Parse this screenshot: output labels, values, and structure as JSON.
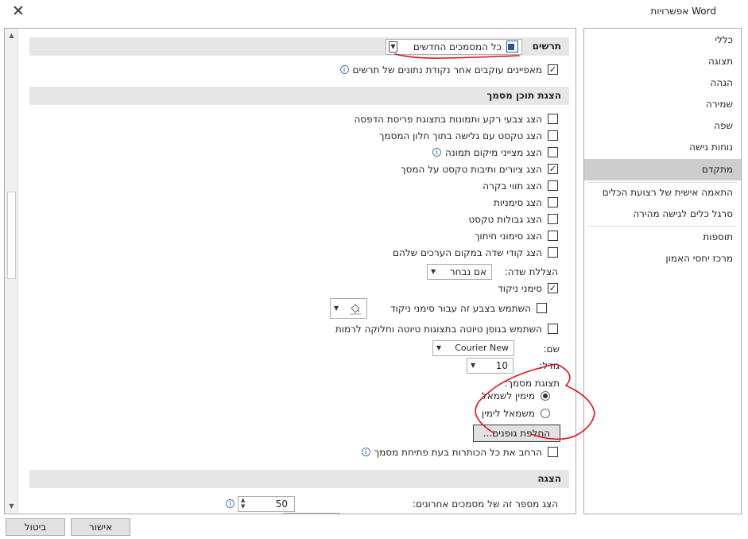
{
  "window": {
    "title": "אפשרויות Word",
    "close_symbol": "✕"
  },
  "sidebar": {
    "items": [
      {
        "label": "כללי"
      },
      {
        "label": "תצוגה"
      },
      {
        "label": "הגהה"
      },
      {
        "label": "שמירה"
      },
      {
        "label": "שפה"
      },
      {
        "label": "נוחות גישה"
      },
      {
        "label": "מתקדם",
        "selected": true
      },
      {
        "label": "התאמה אישית של רצועת הכלים"
      },
      {
        "label": "סרגל כלים לגישה מהירה"
      },
      {
        "label": "תוספות"
      },
      {
        "label": "מרכז יחסי האמון"
      }
    ]
  },
  "main": {
    "section_charts": {
      "title": "תרשים",
      "dropdown_value": "כל המסמכים החדשים",
      "track_properties_label": "מאפיינים עוקבים אחר נקודת נתונים של תרשים"
    },
    "section_doc_content": {
      "title": "הצגת תוכן מסמך",
      "options": [
        {
          "label": "הצג צבעי רקע ותמונות בתצוגת פריסת הדפסה",
          "checked": false
        },
        {
          "label": "הצג טקסט עם גלישה בתוך חלון המסמך",
          "checked": false
        },
        {
          "label": "הצג מצייני מיקום תמונה",
          "checked": false,
          "info": true
        },
        {
          "label": "הצג ציורים ותיבות טקסט על המסך",
          "checked": true
        },
        {
          "label": "הצג תווי בקרה",
          "checked": false
        },
        {
          "label": "הצג סימניות",
          "checked": false
        },
        {
          "label": "הצג גבולות טקסט",
          "checked": false
        },
        {
          "label": "הצג סימוני חיתוך",
          "checked": false
        },
        {
          "label": "הצג קודי שדה במקום הערכים שלהם",
          "checked": false
        }
      ],
      "field_shading_label": "הצללת שדה:",
      "field_shading_value": "אם נבחר",
      "punctuation_marks_label": "סימני ניקוד",
      "punctuation_color_label": "השתמש בצבע זה עבור סימני ניקוד",
      "draft_font_label": "השתמש בגופן טיוטה בתצוגות טיוטה וחלוקה לרמות",
      "name_label": "שם:",
      "name_value": "Courier New",
      "size_label": "גודל:",
      "size_value": "10",
      "doc_view_label": "תצוגת מסמך:",
      "rtl_label": "מימין לשמאל",
      "ltr_label": "משמאל לימין",
      "font_substitution_button": "החלפת גופנים...",
      "expand_headings_label": "הרחב את כל הכותרות בעת פתיחת מסמך"
    },
    "section_display": {
      "title": "הצגה",
      "recent_docs_label": "הצג מספר זה של מסמכים אחרונים:",
      "recent_docs_value": "50"
    }
  },
  "footer": {
    "ok_label": "אישור",
    "cancel_label": "ביטול"
  },
  "colors": {
    "selected_bg": "#cdcdcd",
    "section_bg": "#e6e6e6",
    "annotation": "#e0101a"
  },
  "icons": [
    "close-icon",
    "word-doc-icon",
    "info-icon",
    "paint-bucket-icon",
    "scroll-up-icon",
    "scroll-down-icon"
  ]
}
